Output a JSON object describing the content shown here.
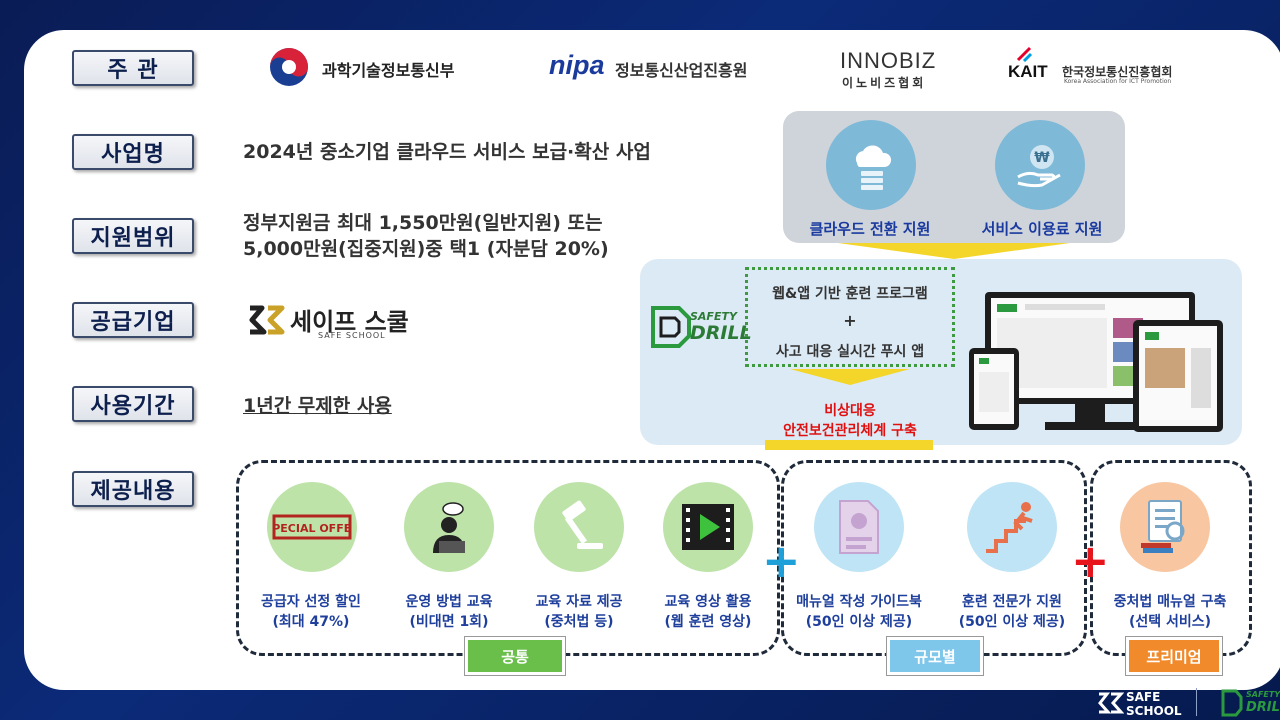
{
  "labels": {
    "host": "주 관",
    "project": "사업명",
    "scope": "지원범위",
    "supplier": "공급기업",
    "period": "사용기간",
    "content": "제공내용"
  },
  "hosts": {
    "msit": "과학기술정보통신부",
    "nipa_mark": "nipa",
    "nipa_name": "정보통신산업진흥원",
    "innobiz_mark": "INNOBIZ",
    "innobiz_name": "이노비즈협회",
    "kait_mark": "KAIT",
    "kait_name": "한국정보통신진흥협회",
    "kait_sub": "Korea Association for ICT Promotion"
  },
  "project_name": "2024년 중소기업 클라우드 서비스 보급·확산 사업",
  "scope": {
    "line1": "정부지원금 최대 1,550만원(일반지원) 또는",
    "line2": "5,000만원(집중지원)중 택1 (자분담 20%)"
  },
  "supplier": {
    "name": "세이프 스쿨",
    "sub": "SAFE SCHOOL"
  },
  "period": "1년간 무제한 사용",
  "support": {
    "cloud": "클라우드 전환 지원",
    "fee": "서비스 이용료 지원"
  },
  "safety_drill": {
    "logo_top": "SAFETY",
    "logo_bottom": "DRILL",
    "program": "웹&앱 기반 훈련 프로그램",
    "plus": "+",
    "app": "사고 대응 실시간 푸시 앱",
    "result_line1": "비상대응",
    "result_line2": "안전보건관리체계 구축"
  },
  "services": [
    {
      "title": "공급자 선정 할인",
      "sub": "(최대 47%)",
      "icon": "special-offer-icon",
      "badge": "SPECIAL OFFER"
    },
    {
      "title": "운영 방법 교육",
      "sub": "(비대면 1회)",
      "icon": "online-training-icon"
    },
    {
      "title": "교육 자료 제공",
      "sub": "(중처법 등)",
      "icon": "gavel-icon"
    },
    {
      "title": "교육 영상 활용",
      "sub": "(웹 훈련 영상)",
      "icon": "video-play-icon"
    },
    {
      "title": "매뉴얼 작성 가이드북",
      "sub": "(50인 이상 제공)",
      "icon": "manual-book-icon"
    },
    {
      "title": "훈련 전문가 지원",
      "sub": "(50인 이상 제공)",
      "icon": "evacuation-icon"
    },
    {
      "title": "중처법 매뉴얼 구축",
      "sub": "(선택 서비스)",
      "icon": "checklist-icon"
    }
  ],
  "tags": {
    "common": "공통",
    "scale": "규모별",
    "premium": "프리미엄"
  },
  "footer": {
    "safe": "SAFE",
    "school": "SCHOOL",
    "safety": "SAFETY",
    "drill": "DRILL"
  },
  "colors": {
    "background": "#0b2a78",
    "label_border": "#3a4a6b",
    "title_blue": "#1e3f9c",
    "result_red": "#e01010",
    "common_green": "#6abf4b",
    "scale_blue": "#7ec6ea",
    "premium_orange": "#f08a2a"
  }
}
